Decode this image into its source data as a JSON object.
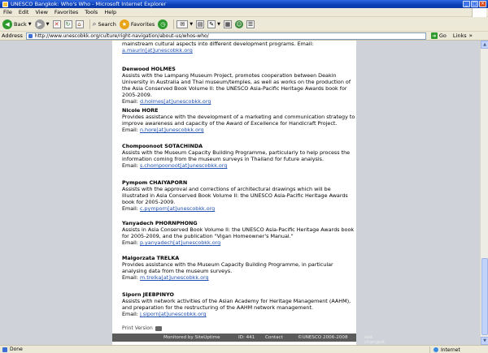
{
  "window": {
    "title": "UNESCO Bangkok: Who's Who - Microsoft Internet Explorer",
    "controls": [
      "_",
      "□",
      "×"
    ]
  },
  "menu": [
    "File",
    "Edit",
    "View",
    "Favorites",
    "Tools",
    "Help"
  ],
  "toolbar": {
    "back_label": "Back",
    "search_label": "Search",
    "favorites_label": "Favorites"
  },
  "address": {
    "label": "Address",
    "url": "http://www.unescobkk.org/culture/right-navigation/about-us/whos-who/",
    "go_label": "Go",
    "links_label": "Links"
  },
  "content": {
    "top_fragment": "mainstream cultural aspects into different development programs.",
    "top_email_label": "Email:",
    "top_email": "a.maurin[at]unescobkk.org",
    "people": [
      {
        "name": "Denwood HOLMES",
        "desc": "Assists with the Lampang Museum Project, promotes cooperation between Deakin University in Australia and Thai museum/temples, as well as works on the production of the Asia Conserved Book Volume II: the UNESCO Asia-Pacific Heritage Awards book for 2005-2009.",
        "email_label": "Email:",
        "email": "d.holmes[at]unescobkk.org"
      },
      {
        "name": "Nicole HORE",
        "desc": "Provides assistance with the development of a marketing and communication strategy to improve awareness and capacity of the Award of Excellence for Handicraft Project.",
        "email_label": "Email:",
        "email": "n.hore[at]unescobkk.org"
      },
      {
        "name": "Chompoonoot SOTACHINDA",
        "desc": "Assists with the Museum Capacity Building Programme, particularly to help process the information coming from the museum surveys in Thailand for future analysis.",
        "email_label": "Email:",
        "email": "s.chompoonoot[at]unescobkk.org"
      },
      {
        "name": "Pympom CHAIYAPORN",
        "desc": "Assists with the approval and corrections of architectural drawings which will be illustrated in Asia Conserved Book Volume II: the UNESCO Asia-Pacific Heritage Awards book for 2005-2009.",
        "email_label": "Email:",
        "email": "c.pymporn[at]unescobkk.org"
      },
      {
        "name": "Yanyadech PHORNPHONG",
        "desc": "Assists in Asia Conserved Book Volume II: the UNESCO Asia-Pacific Heritage Awards book for 2005-2009, and the publication \"Vigan Homeowner's Manual.\"",
        "email_label": "Email:",
        "email": "p.yanyadech[at]unescobkk.org"
      },
      {
        "name": "Malgorzata TRELKA",
        "desc": "Provides assistance with the Museum Capacity Building Programme, in particular analysing data from the museum surveys.",
        "email_label": "Email:",
        "email": "m.trelka[at]unescobkk.org"
      },
      {
        "name": "Siporn JEEBPINYO",
        "desc": "Assists with network activities of the Asian Academy for Heritage Management (AAHM), and preparation for the restructuring of the AAHM network management.",
        "email_label": "Email:",
        "email": "j.siporn[at]unescobkk.org"
      }
    ]
  },
  "print_version": "Print Version",
  "footer": {
    "monitored": "Monitored by SiteUptime",
    "id": "ID: 441",
    "contact": "Contact",
    "copyright": "©UNESCO 2006-2008",
    "last_changed": "last changed: 03.04.2009"
  },
  "status": {
    "text": "Done",
    "zone": "Internet"
  }
}
